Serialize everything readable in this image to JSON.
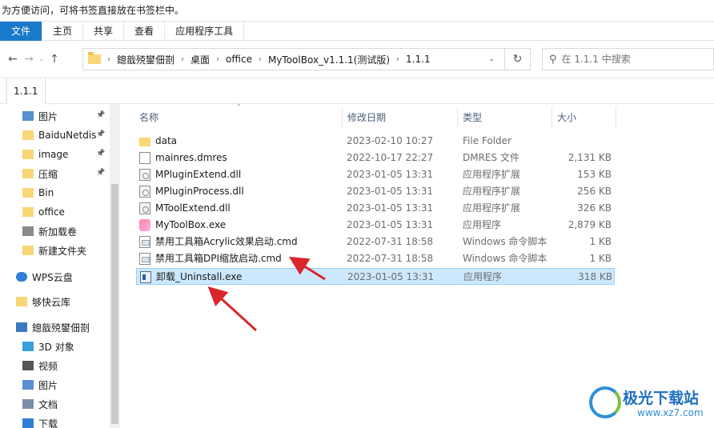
{
  "favorites_bar": {
    "hint": "为方便访问，可将书签直接放在书签栏中。"
  },
  "ribbon": {
    "tabs": [
      "文件",
      "主页",
      "共享",
      "查看",
      "应用程序工具"
    ]
  },
  "address": {
    "crumbs": [
      "鎴戠殑鐢佃剳",
      "桌面",
      "office",
      "MyToolBox_v1.1.1(测试版)",
      "1.1.1"
    ],
    "search_placeholder": "在 1.1.1 中搜索"
  },
  "tab": {
    "label": "1.1.1"
  },
  "columns": {
    "name": "名称",
    "date": "修改日期",
    "type": "类型",
    "size": "大小"
  },
  "sidebar": {
    "items": [
      {
        "label": "图片",
        "icon": "pictures-icon",
        "pinned": true
      },
      {
        "label": "BaiduNetdis",
        "icon": "folder-icon",
        "pinned": true
      },
      {
        "label": "image",
        "icon": "folder-icon",
        "pinned": true
      },
      {
        "label": "压缩",
        "icon": "folder-icon",
        "pinned": true
      },
      {
        "label": "Bin",
        "icon": "folder-icon",
        "pinned": false
      },
      {
        "label": "office",
        "icon": "folder-icon",
        "pinned": false
      },
      {
        "label": "新加载卷",
        "icon": "drive-icon",
        "pinned": false
      },
      {
        "label": "新建文件夹",
        "icon": "folder-icon",
        "pinned": false
      },
      {
        "label": "WPS云盘",
        "icon": "cloud-icon",
        "pinned": false
      },
      {
        "label": "够快云库",
        "icon": "folder-icon",
        "pinned": false
      },
      {
        "label": "鎴戠殑鐢佃剳",
        "icon": "computer-icon",
        "pinned": false
      },
      {
        "label": "3D 对象",
        "icon": "3d-objects-icon",
        "pinned": false
      },
      {
        "label": "视频",
        "icon": "video-icon",
        "pinned": false
      },
      {
        "label": "图片",
        "icon": "pictures-icon",
        "pinned": false
      },
      {
        "label": "文档",
        "icon": "documents-icon",
        "pinned": false
      },
      {
        "label": "下载",
        "icon": "download-icon",
        "pinned": false
      }
    ]
  },
  "files": [
    {
      "name": "data",
      "date": "2023-02-10 10:27",
      "type": "File Folder",
      "size": "",
      "icon": "folder-icon"
    },
    {
      "name": "mainres.dmres",
      "date": "2022-10-17 22:27",
      "type": "DMRES 文件",
      "size": "2,131 KB",
      "icon": "document-icon"
    },
    {
      "name": "MPluginExtend.dll",
      "date": "2023-01-05 13:31",
      "type": "应用程序扩展",
      "size": "153 KB",
      "icon": "dll-icon"
    },
    {
      "name": "MPluginProcess.dll",
      "date": "2023-01-05 13:31",
      "type": "应用程序扩展",
      "size": "256 KB",
      "icon": "dll-icon"
    },
    {
      "name": "MToolExtend.dll",
      "date": "2023-01-05 13:31",
      "type": "应用程序扩展",
      "size": "326 KB",
      "icon": "dll-icon"
    },
    {
      "name": "MyToolBox.exe",
      "date": "2023-01-05 13:31",
      "type": "应用程序",
      "size": "2,879 KB",
      "icon": "app-icon"
    },
    {
      "name": "禁用工具箱Acrylic效果启动.cmd",
      "date": "2022-07-31 18:58",
      "type": "Windows 命令脚本",
      "size": "1 KB",
      "icon": "cmd-icon"
    },
    {
      "name": "禁用工具箱DPI缩放启动.cmd",
      "date": "2022-07-31 18:58",
      "type": "Windows 命令脚本",
      "size": "1 KB",
      "icon": "cmd-icon"
    },
    {
      "name": "卸载_Uninstall.exe",
      "date": "2023-01-05 13:31",
      "type": "应用程序",
      "size": "318 KB",
      "icon": "uninstall-icon",
      "selected": true
    }
  ],
  "watermark": {
    "brand": "极光下载站",
    "url": "www.xz7.com"
  },
  "colors": {
    "accent": "#1979ca",
    "selection": "#cce8ff",
    "arrow": "#d9262b"
  }
}
